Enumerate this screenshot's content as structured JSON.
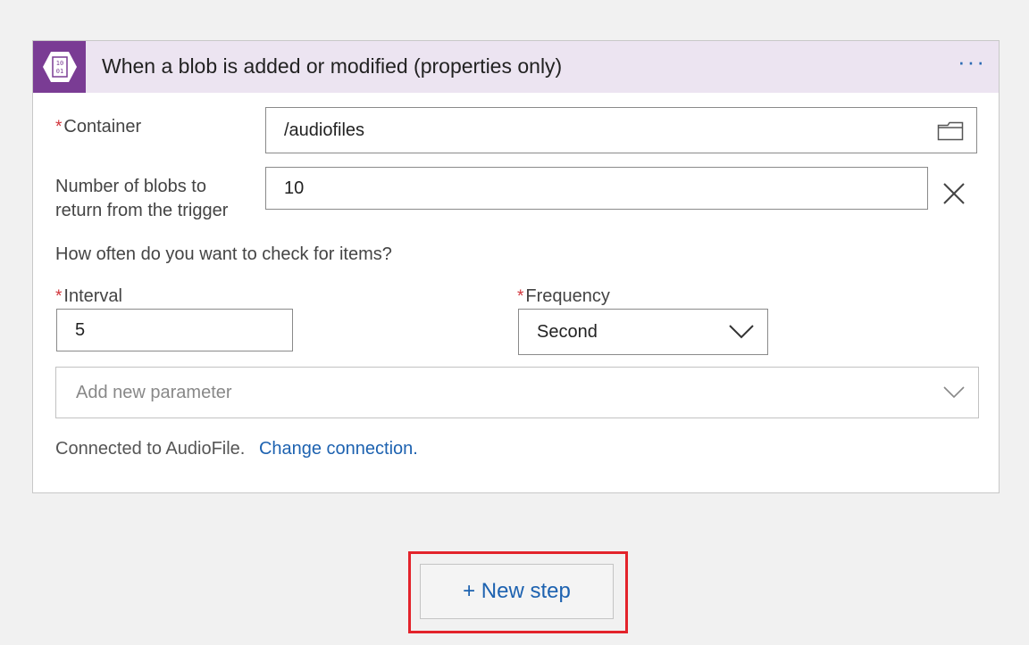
{
  "trigger": {
    "title": "When a blob is added or modified (properties only)",
    "more_label": "···",
    "icon": "blob-storage-icon",
    "icon_text_top": "10",
    "icon_text_bottom": "01"
  },
  "fields": {
    "container": {
      "required_mark": "*",
      "label": "Container",
      "value": "/audiofiles",
      "icon": "folder-icon"
    },
    "blob_count": {
      "label_line1": "Number of blobs to",
      "label_line2": "return from the trigger",
      "value": "10",
      "clear_icon": "close-icon"
    },
    "recurrence_prompt": "How often do you want to check for items?",
    "interval": {
      "required_mark": "*",
      "label": "Interval",
      "value": "5"
    },
    "frequency": {
      "required_mark": "*",
      "label": "Frequency",
      "value": "Second",
      "icon": "chevron-down-icon"
    },
    "add_parameter": {
      "placeholder": "Add new parameter",
      "icon": "chevron-down-icon"
    }
  },
  "connection": {
    "status_text": "Connected to AudioFile.",
    "change_link": "Change connection."
  },
  "new_step": {
    "label": "+ New step"
  },
  "colors": {
    "accent_purple": "#7a3c94",
    "header_bg": "#ece4f1",
    "link_blue": "#1d62b0",
    "required_red": "#d1343b",
    "highlight_red": "#e3232b"
  }
}
